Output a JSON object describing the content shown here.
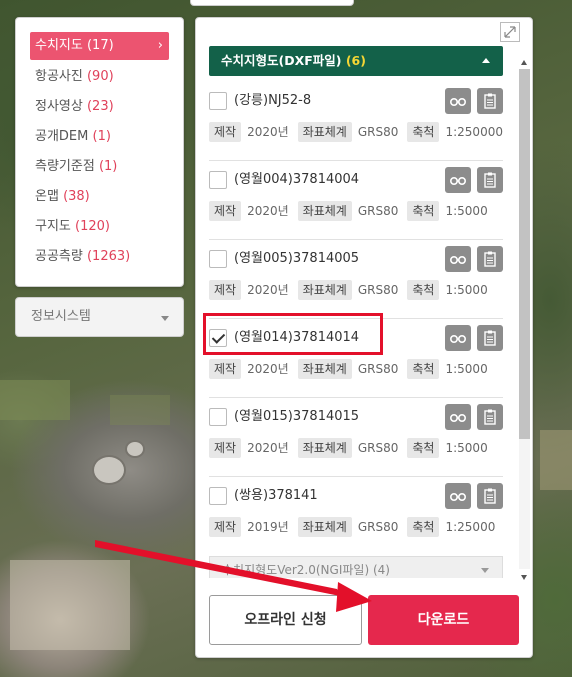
{
  "categories": [
    {
      "label": "수치지도",
      "count": "(17)",
      "active": true
    },
    {
      "label": "항공사진",
      "count": "(90)"
    },
    {
      "label": "정사영상",
      "count": "(23)"
    },
    {
      "label": "공개DEM",
      "count": "(1)"
    },
    {
      "label": "측량기준점",
      "count": "(1)"
    },
    {
      "label": "온맵",
      "count": "(38)"
    },
    {
      "label": "구지도",
      "count": "(120)"
    },
    {
      "label": "공공측량",
      "count": "(1263)"
    }
  ],
  "info_system": {
    "label": "정보시스템"
  },
  "section": {
    "title": "수치지형도(DXF파일)",
    "count": "(6)"
  },
  "meta_keys": {
    "made": "제작",
    "crs": "좌표체계",
    "scale": "축척"
  },
  "files": [
    {
      "name": "(강릉)NJ52-8",
      "year": "2020년",
      "crs": "GRS80",
      "scale": "1:250000",
      "checked": false
    },
    {
      "name": "(영월004)37814004",
      "year": "2020년",
      "crs": "GRS80",
      "scale": "1:5000",
      "checked": false
    },
    {
      "name": "(영월005)37814005",
      "year": "2020년",
      "crs": "GRS80",
      "scale": "1:5000",
      "checked": false
    },
    {
      "name": "(영월014)37814014",
      "year": "2020년",
      "crs": "GRS80",
      "scale": "1:5000",
      "checked": true
    },
    {
      "name": "(영월015)37814015",
      "year": "2020년",
      "crs": "GRS80",
      "scale": "1:5000",
      "checked": false
    },
    {
      "name": "(쌍용)378141",
      "year": "2019년",
      "crs": "GRS80",
      "scale": "1:25000",
      "checked": false
    }
  ],
  "section2": {
    "title": "수치지형도Ver2.0(NGI파일) (4)"
  },
  "buttons": {
    "offline": "오프라인 신청",
    "download": "다운로드"
  },
  "colors": {
    "accent": "#e5284d",
    "section_header": "#136149",
    "highlight": "#e3102a"
  }
}
